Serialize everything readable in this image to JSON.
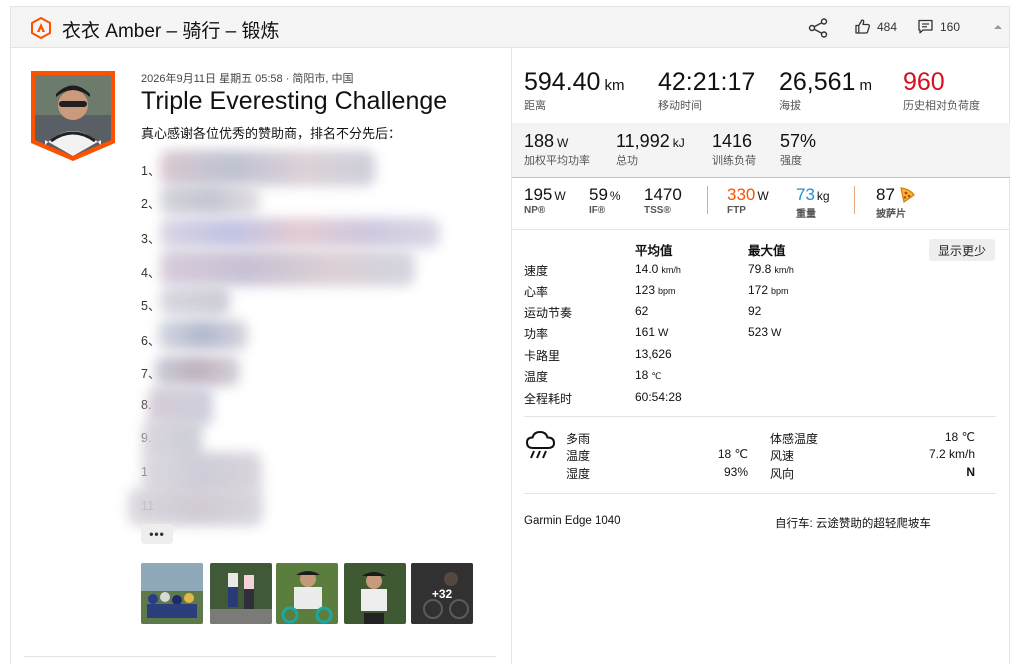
{
  "header": {
    "title": "衣衣 Amber – 骑行 – 锻炼",
    "kudos_count": "484",
    "comment_count": "160"
  },
  "activity": {
    "meta": "2026年9月11日 星期五 05:58 · 简阳市, 中国",
    "title": "Triple Everesting Challenge",
    "description": "真心感谢各位优秀的赞助商，排名不分先后：",
    "sponsors": [
      "1、",
      "2、",
      "3、",
      "4、",
      "5、",
      "6、",
      "7、",
      "8.",
      "9.",
      "1",
      "11"
    ],
    "more_label": "•••",
    "photo_more": "+32"
  },
  "stats_primary": [
    {
      "value": "594.40",
      "unit": "km",
      "label": "距离"
    },
    {
      "value": "42:21:17",
      "unit": "",
      "label": "移动时间"
    },
    {
      "value": "26,561",
      "unit": "m",
      "label": "海拔"
    },
    {
      "value": "960",
      "unit": "",
      "label": "历史相对负荷度"
    }
  ],
  "stats_secondary": [
    {
      "value": "188",
      "unit": "W",
      "label": "加权平均功率"
    },
    {
      "value": "11,992",
      "unit": "kJ",
      "label": "总功"
    },
    {
      "value": "1416",
      "unit": "",
      "label": "训练负荷"
    },
    {
      "value": "57%",
      "unit": "",
      "label": "强度"
    }
  ],
  "stats_power": [
    {
      "value": "195",
      "unit": "W",
      "label": "NP®"
    },
    {
      "value": "59",
      "unit": "%",
      "label": "IF®"
    },
    {
      "value": "1470",
      "unit": "",
      "label": "TSS®"
    },
    {
      "value": "330",
      "unit": "W",
      "label": "FTP"
    },
    {
      "value": "73",
      "unit": "kg",
      "label": "重量"
    },
    {
      "value": "87",
      "unit": "",
      "label": "披萨片"
    }
  ],
  "details": {
    "col_avg": "平均值",
    "col_max": "最大值",
    "show_less": "显示更少",
    "rows": [
      {
        "label": "速度",
        "avg": "14.0",
        "avg_unit": "km/h",
        "max": "79.8",
        "max_unit": "km/h"
      },
      {
        "label": "心率",
        "avg": "123",
        "avg_unit": "bpm",
        "max": "172",
        "max_unit": "bpm"
      },
      {
        "label": "运动节奏",
        "avg": "62",
        "avg_unit": "",
        "max": "92",
        "max_unit": ""
      },
      {
        "label": "功率",
        "avg": "161",
        "avg_unit": "W",
        "max": "523",
        "max_unit": "W"
      },
      {
        "label": "卡路里",
        "avg": "13,626",
        "avg_unit": "",
        "max": "",
        "max_unit": ""
      },
      {
        "label": "温度",
        "avg": "18",
        "avg_unit": "℃",
        "max": "",
        "max_unit": ""
      },
      {
        "label": "全程耗时",
        "avg": "60:54:28",
        "avg_unit": "",
        "max": "",
        "max_unit": ""
      }
    ]
  },
  "weather": {
    "condition": "多雨",
    "temp_label": "温度",
    "temp_value": "18 ℃",
    "humidity_label": "湿度",
    "humidity_value": "93%",
    "feels_label": "体感温度",
    "feels_value": "18 ℃",
    "wind_label": "风速",
    "wind_value": "7.2 km/h",
    "dir_label": "风向",
    "dir_value": "N"
  },
  "gear": {
    "device": "Garmin Edge 1040",
    "bike": "自行车: 云途赞助的超轻爬坡车"
  },
  "colors": {
    "brand": "#fc5200",
    "ftp": "#fc5200",
    "weight": "#1f8fd6"
  }
}
